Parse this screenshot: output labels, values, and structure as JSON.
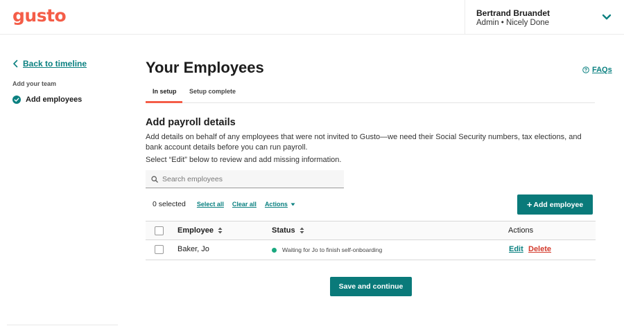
{
  "header": {
    "logo_text": "gusto",
    "user_name": "Bertrand Bruandet",
    "user_role": "Admin • Nicely Done"
  },
  "sidebar": {
    "back_label": "Back to timeline",
    "section_label": "Add your team",
    "step_label": "Add employees"
  },
  "faq_label": "FAQs",
  "main": {
    "title": "Your Employees",
    "tabs": [
      {
        "label": "In setup",
        "active": true
      },
      {
        "label": "Setup complete",
        "active": false
      }
    ],
    "section_title": "Add payroll details",
    "description": "Add details on behalf of any employees that were not invited to Gusto—we need their Social Security numbers, tax elections, and bank account details before you can run payroll.",
    "instruction": "Select “Edit” below to review and add missing information.",
    "search_placeholder": "Search employees",
    "toolbar": {
      "selected_count": "0 selected",
      "select_all": "Select all",
      "clear_all": "Clear all",
      "actions": "Actions"
    },
    "add_employee_label": "Add employee",
    "table": {
      "headers": {
        "employee": "Employee",
        "status": "Status",
        "actions": "Actions"
      },
      "rows": [
        {
          "employee": "Baker, Jo",
          "status": "Waiting for Jo to finish self-onboarding",
          "edit": "Edit",
          "delete": "Delete"
        }
      ]
    },
    "save_label": "Save and continue"
  },
  "colors": {
    "brand": "#f45d48",
    "primary": "#0a7a7a",
    "link": "#0a8080",
    "delete": "#d33a2c",
    "status_green": "#1aa87f"
  },
  "icons": [
    "chevron-down-icon",
    "chevron-left-icon",
    "check-circle-icon",
    "question-circle-icon",
    "search-icon",
    "sort-icon",
    "caret-down-icon",
    "plus-icon"
  ]
}
